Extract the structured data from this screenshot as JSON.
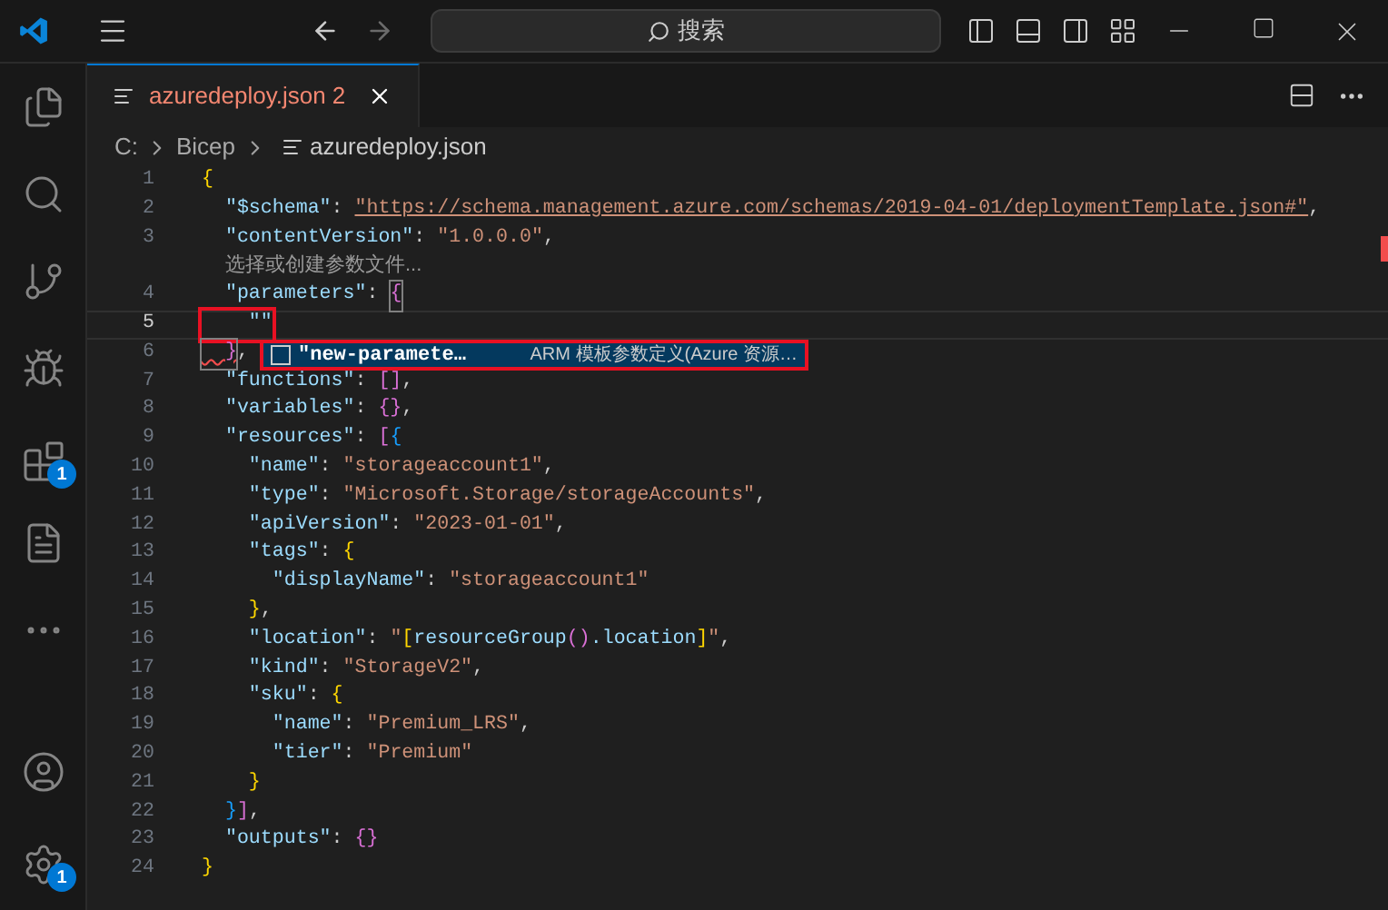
{
  "title_bar": {
    "search_placeholder": "搜索",
    "back_disabled": false,
    "forward_disabled": true
  },
  "activity_bar": {
    "items": [
      {
        "kind": "files",
        "selected": false
      },
      {
        "kind": "search",
        "selected": false
      },
      {
        "kind": "source-control",
        "selected": false
      },
      {
        "kind": "debug",
        "selected": false
      },
      {
        "kind": "extensions",
        "selected": false,
        "badge": "1"
      },
      {
        "kind": "document",
        "selected": false
      },
      {
        "kind": "more",
        "selected": false
      }
    ],
    "bottom_items": [
      {
        "kind": "account"
      },
      {
        "kind": "settings",
        "badge": "1"
      }
    ]
  },
  "tabs": [
    {
      "label": "azuredeploy.json 2",
      "selected": true,
      "has_errors": true
    }
  ],
  "breadcrumbs": [
    {
      "label": "C:",
      "kind": "folder"
    },
    {
      "label": "Bicep",
      "kind": "folder"
    },
    {
      "label": "azuredeploy.json",
      "kind": "file"
    }
  ],
  "editor": {
    "lines": [
      {
        "number": "1",
        "tokens": [
          {
            "t": "{",
            "kind": "b1"
          }
        ]
      },
      {
        "number": "2",
        "tokens": [
          {
            "t": "  \"$schema\"",
            "kind": "key"
          },
          {
            "t": ": ",
            "kind": "p"
          },
          {
            "t": "\"https://schema.management.azure.com/schemas/2019-04-01/deploymentTemplate.json#\"",
            "kind": "link"
          },
          {
            "t": ",",
            "kind": "p"
          }
        ]
      },
      {
        "number": "3",
        "tokens": [
          {
            "t": "  \"contentVersion\"",
            "kind": "key"
          },
          {
            "t": ": ",
            "kind": "p"
          },
          {
            "t": "\"1.0.0.0\"",
            "kind": "str"
          },
          {
            "t": ",",
            "kind": "p"
          }
        ],
        "codelens": "选择或创建参数文件..."
      },
      {
        "number": "4",
        "tokens": [
          {
            "t": "  \"parameters\"",
            "kind": "key"
          },
          {
            "t": ": ",
            "kind": "p"
          },
          {
            "t": "{",
            "kind": "b2",
            "matched": true
          }
        ]
      },
      {
        "number": "5",
        "current": true,
        "tokens": [
          {
            "t": "    \"\"",
            "kind": "key",
            "highlighted": true
          }
        ]
      },
      {
        "number": "6",
        "tokens": [
          {
            "t": "  }",
            "kind": "b2",
            "error": true,
            "matched": true
          },
          {
            "t": ",",
            "kind": "p"
          }
        ]
      },
      {
        "number": "7",
        "tokens": [
          {
            "t": "  \"functions\"",
            "kind": "key"
          },
          {
            "t": ": ",
            "kind": "p"
          },
          {
            "t": "[]",
            "kind": "b2"
          },
          {
            "t": ",",
            "kind": "p"
          }
        ]
      },
      {
        "number": "8",
        "tokens": [
          {
            "t": "  \"variables\"",
            "kind": "key"
          },
          {
            "t": ": ",
            "kind": "p"
          },
          {
            "t": "{}",
            "kind": "b2"
          },
          {
            "t": ",",
            "kind": "p"
          }
        ]
      },
      {
        "number": "9",
        "tokens": [
          {
            "t": "  \"resources\"",
            "kind": "key"
          },
          {
            "t": ": ",
            "kind": "p"
          },
          {
            "t": "[",
            "kind": "b2"
          },
          {
            "t": "{",
            "kind": "b3"
          }
        ]
      },
      {
        "number": "10",
        "tokens": [
          {
            "t": "    \"name\"",
            "kind": "key"
          },
          {
            "t": ": ",
            "kind": "p"
          },
          {
            "t": "\"storageaccount1\"",
            "kind": "str"
          },
          {
            "t": ",",
            "kind": "p"
          }
        ]
      },
      {
        "number": "11",
        "tokens": [
          {
            "t": "    \"type\"",
            "kind": "key"
          },
          {
            "t": ": ",
            "kind": "p"
          },
          {
            "t": "\"Microsoft.Storage/storageAccounts\"",
            "kind": "str"
          },
          {
            "t": ",",
            "kind": "p"
          }
        ]
      },
      {
        "number": "12",
        "tokens": [
          {
            "t": "    \"apiVersion\"",
            "kind": "key"
          },
          {
            "t": ": ",
            "kind": "p"
          },
          {
            "t": "\"2023-01-01\"",
            "kind": "str"
          },
          {
            "t": ",",
            "kind": "p"
          }
        ]
      },
      {
        "number": "13",
        "tokens": [
          {
            "t": "    \"tags\"",
            "kind": "key"
          },
          {
            "t": ": ",
            "kind": "p"
          },
          {
            "t": "{",
            "kind": "b1"
          }
        ]
      },
      {
        "number": "14",
        "tokens": [
          {
            "t": "      \"displayName\"",
            "kind": "key"
          },
          {
            "t": ": ",
            "kind": "p"
          },
          {
            "t": "\"storageaccount1\"",
            "kind": "str"
          }
        ]
      },
      {
        "number": "15",
        "tokens": [
          {
            "t": "    }",
            "kind": "b1"
          },
          {
            "t": ",",
            "kind": "p"
          }
        ]
      },
      {
        "number": "16",
        "tokens": [
          {
            "t": "    \"location\"",
            "kind": "key"
          },
          {
            "t": ": ",
            "kind": "p"
          },
          {
            "t": "\"",
            "kind": "str"
          },
          {
            "t": "[",
            "kind": "b1"
          },
          {
            "t": "resourceGroup",
            "kind": "key"
          },
          {
            "t": "()",
            "kind": "b2"
          },
          {
            "t": ".location",
            "kind": "key"
          },
          {
            "t": "]",
            "kind": "b1"
          },
          {
            "t": "\"",
            "kind": "str"
          },
          {
            "t": ",",
            "kind": "p"
          }
        ]
      },
      {
        "number": "17",
        "tokens": [
          {
            "t": "    \"kind\"",
            "kind": "key"
          },
          {
            "t": ": ",
            "kind": "p"
          },
          {
            "t": "\"StorageV2\"",
            "kind": "str"
          },
          {
            "t": ",",
            "kind": "p"
          }
        ]
      },
      {
        "number": "18",
        "tokens": [
          {
            "t": "    \"sku\"",
            "kind": "key"
          },
          {
            "t": ": ",
            "kind": "p"
          },
          {
            "t": "{",
            "kind": "b1"
          }
        ]
      },
      {
        "number": "19",
        "tokens": [
          {
            "t": "      \"name\"",
            "kind": "key"
          },
          {
            "t": ": ",
            "kind": "p"
          },
          {
            "t": "\"Premium_LRS\"",
            "kind": "str"
          },
          {
            "t": ",",
            "kind": "p"
          }
        ]
      },
      {
        "number": "20",
        "tokens": [
          {
            "t": "      \"tier\"",
            "kind": "key"
          },
          {
            "t": ": ",
            "kind": "p"
          },
          {
            "t": "\"Premium\"",
            "kind": "str"
          }
        ]
      },
      {
        "number": "21",
        "tokens": [
          {
            "t": "    }",
            "kind": "b1"
          }
        ]
      },
      {
        "number": "22",
        "tokens": [
          {
            "t": "  }",
            "kind": "b3"
          },
          {
            "t": "]",
            "kind": "b2"
          },
          {
            "t": ",",
            "kind": "p"
          }
        ]
      },
      {
        "number": "23",
        "tokens": [
          {
            "t": "  \"outputs\"",
            "kind": "key"
          },
          {
            "t": ": ",
            "kind": "p"
          },
          {
            "t": "{}",
            "kind": "b2"
          }
        ]
      },
      {
        "number": "24",
        "tokens": [
          {
            "t": "}",
            "kind": "b1"
          }
        ]
      }
    ],
    "suggestion": {
      "label": "\"new-paramete…",
      "detail": "ARM 模板参数定义(Azure 资源…",
      "selected": true,
      "highlighted": true
    }
  }
}
